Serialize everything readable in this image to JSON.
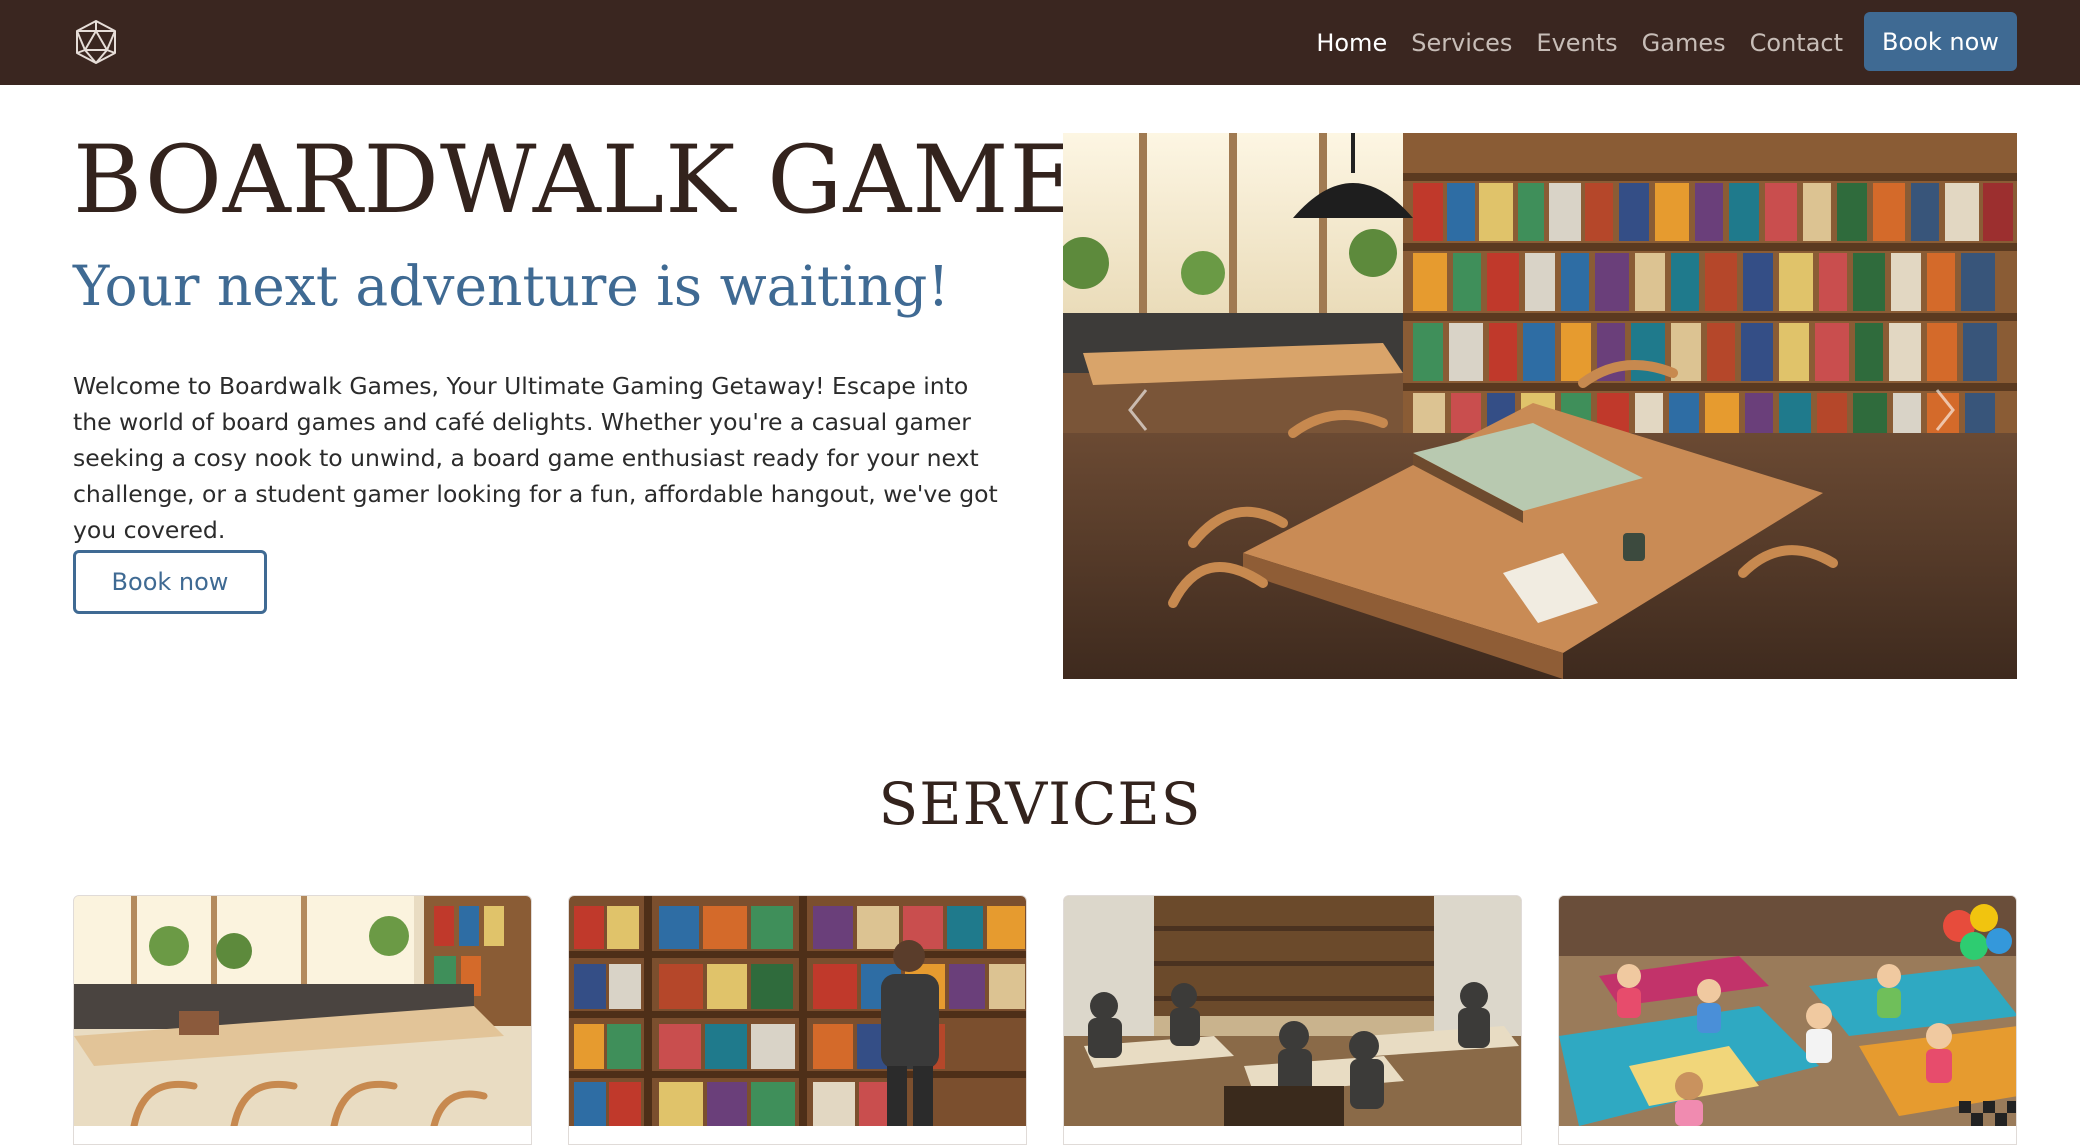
{
  "navbar": {
    "logo_icon": "d20-dice-icon",
    "links": [
      "Home",
      "Services",
      "Events",
      "Games",
      "Contact"
    ],
    "active_link": "Home",
    "book_label": "Book now",
    "colors": {
      "background": "#3a2620",
      "accent": "#3f6a93"
    }
  },
  "hero": {
    "title": "BOARDWALK GAMES",
    "subtitle": "Your next adventure is waiting!",
    "description": "Welcome to Boardwalk Games, Your Ultimate Gaming Getaway! Escape into the world of board games and café delights. Whether you're a casual gamer seeking a cosy nook to unwind, a board game enthusiast ready for your next challenge, or a student gamer looking for a fun, affordable hangout, we've got you covered.",
    "book_label": "Book now",
    "image": "board-game-cafe-photo",
    "carousel": {
      "prev_icon": "chevron-left-icon",
      "next_icon": "chevron-right-icon"
    }
  },
  "services": {
    "title": "SERVICES",
    "cards": [
      {
        "image": "cafe-seating-photo"
      },
      {
        "image": "game-shelves-photo"
      },
      {
        "image": "chess-tournament-photo"
      },
      {
        "image": "kids-party-photo"
      }
    ]
  }
}
